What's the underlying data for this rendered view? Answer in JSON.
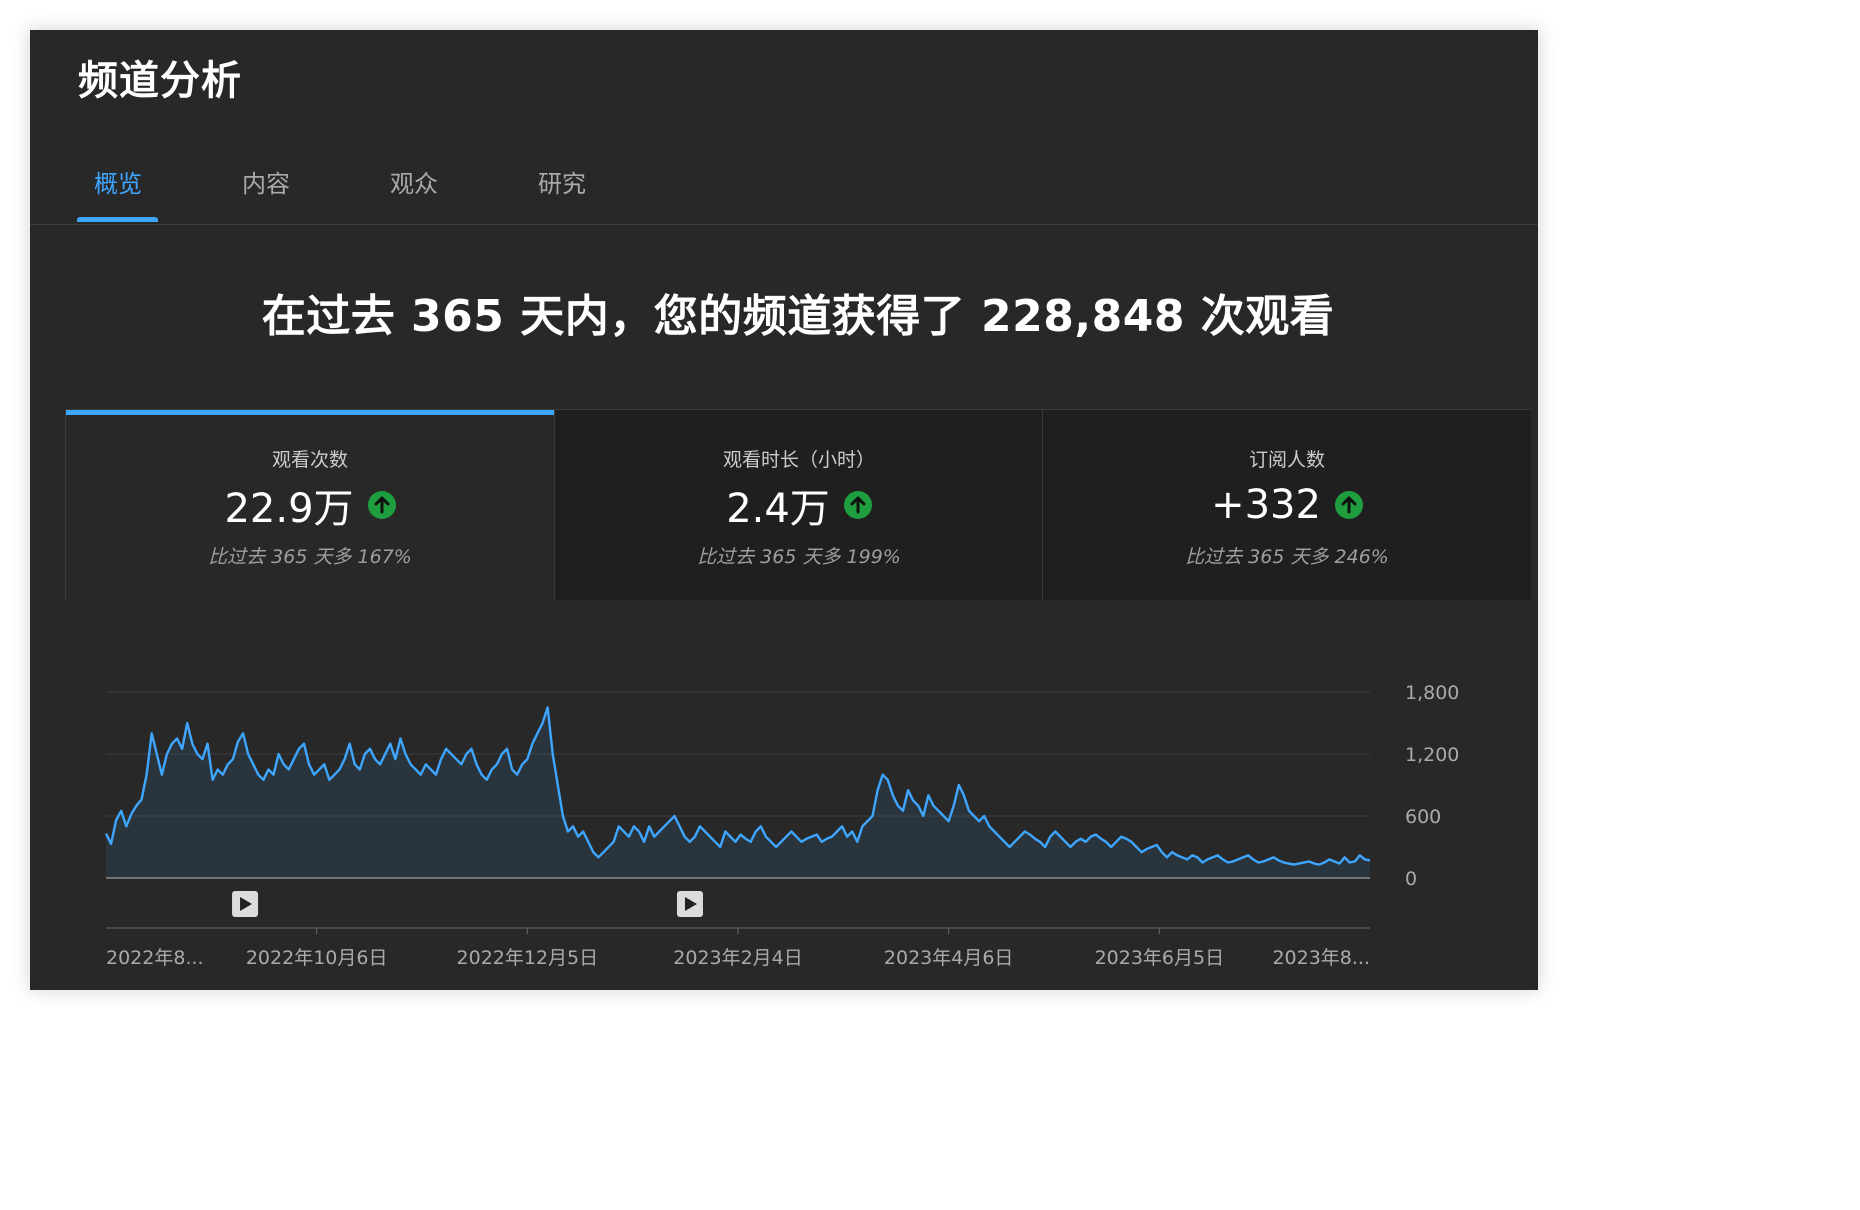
{
  "header": {
    "title": "频道分析"
  },
  "tabs": [
    {
      "label": "概览",
      "active": true
    },
    {
      "label": "内容",
      "active": false
    },
    {
      "label": "观众",
      "active": false
    },
    {
      "label": "研究",
      "active": false
    }
  ],
  "headline": "在过去 365 天内，您的频道获得了 228,848 次观看",
  "cards": [
    {
      "label": "观看次数",
      "value": "22.9万",
      "comparison": "比过去 365 天多 167%",
      "trend": "up",
      "active": true
    },
    {
      "label": "观看时长（小时）",
      "value": "2.4万",
      "comparison": "比过去 365 天多 199%",
      "trend": "up",
      "active": false
    },
    {
      "label": "订阅人数",
      "value": "+332",
      "comparison": "比过去 365 天多 246%",
      "trend": "up",
      "active": false
    }
  ],
  "colors": {
    "accent": "#3ea6ff",
    "line": "#3ea6ff",
    "trend_up": "#1e9e3e",
    "background": "#282828"
  },
  "chart_data": {
    "type": "area",
    "ylim": [
      0,
      1800
    ],
    "y_ticks": [
      0,
      600,
      1200,
      1800
    ],
    "y_tick_labels": [
      "0",
      "600",
      "1,200",
      "1,800"
    ],
    "x_tick_labels": [
      "2022年8...",
      "2022年10月6日",
      "2022年12月5日",
      "2023年2月4日",
      "2023年4月6日",
      "2023年6月5日",
      "2023年8..."
    ],
    "grid": true,
    "markers": [
      {
        "icon": "play-icon",
        "position": 0.11
      },
      {
        "icon": "play-icon",
        "position": 0.462
      }
    ],
    "series": [
      {
        "values": [
          430,
          330,
          560,
          650,
          500,
          620,
          700,
          760,
          1000,
          1400,
          1200,
          1000,
          1200,
          1300,
          1350,
          1250,
          1500,
          1300,
          1200,
          1150,
          1300,
          950,
          1050,
          1000,
          1100,
          1150,
          1320,
          1400,
          1200,
          1100,
          1000,
          950,
          1050,
          1000,
          1200,
          1100,
          1050,
          1150,
          1250,
          1300,
          1100,
          1000,
          1050,
          1100,
          950,
          1000,
          1050,
          1150,
          1300,
          1100,
          1050,
          1200,
          1250,
          1150,
          1100,
          1200,
          1300,
          1150,
          1350,
          1200,
          1100,
          1050,
          1000,
          1100,
          1050,
          1000,
          1150,
          1250,
          1200,
          1150,
          1100,
          1200,
          1250,
          1100,
          1000,
          950,
          1050,
          1100,
          1200,
          1250,
          1050,
          1000,
          1100,
          1150,
          1300,
          1400,
          1500,
          1650,
          1200,
          900,
          600,
          450,
          500,
          400,
          450,
          350,
          250,
          200,
          250,
          300,
          350,
          500,
          450,
          400,
          500,
          450,
          350,
          500,
          400,
          450,
          500,
          550,
          600,
          500,
          400,
          350,
          400,
          500,
          450,
          400,
          350,
          300,
          450,
          400,
          350,
          420,
          380,
          350,
          450,
          500,
          400,
          350,
          300,
          350,
          400,
          450,
          400,
          350,
          380,
          400,
          420,
          350,
          380,
          400,
          450,
          500,
          400,
          450,
          350,
          500,
          550,
          600,
          850,
          1000,
          950,
          800,
          700,
          650,
          850,
          750,
          700,
          600,
          800,
          700,
          650,
          600,
          550,
          700,
          900,
          800,
          650,
          600,
          550,
          600,
          500,
          450,
          400,
          350,
          300,
          350,
          400,
          450,
          420,
          380,
          350,
          300,
          400,
          450,
          400,
          350,
          300,
          350,
          380,
          350,
          400,
          420,
          380,
          350,
          300,
          350,
          400,
          380,
          350,
          300,
          250,
          280,
          300,
          320,
          250,
          200,
          250,
          220,
          200,
          180,
          220,
          200,
          150,
          180,
          200,
          220,
          180,
          150,
          160,
          180,
          200,
          220,
          180,
          150,
          160,
          180,
          200,
          170,
          150,
          140,
          130,
          140,
          150,
          160,
          140,
          130,
          150,
          180,
          160,
          140,
          200,
          150,
          160,
          220,
          180,
          170
        ],
        "color": "#3ea6ff"
      }
    ]
  }
}
